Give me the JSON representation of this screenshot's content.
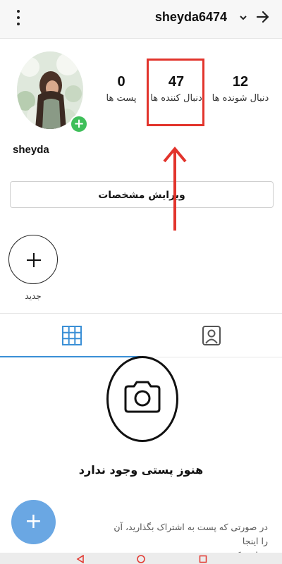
{
  "header": {
    "username": "sheyda6474",
    "menu_icon": "kebab-menu-icon",
    "dropdown_icon": "chevron-down-icon",
    "back_icon": "arrow-right-icon"
  },
  "profile": {
    "display_name": "sheyda",
    "stats": {
      "posts": {
        "count": "0",
        "label": "پست ها"
      },
      "followers": {
        "count": "47",
        "label": "دنبال کننده ها"
      },
      "following": {
        "count": "12",
        "label": "دنبال شونده ها"
      }
    },
    "edit_button": "ویرایش مشخصات"
  },
  "stories": {
    "new_label": "جدید"
  },
  "tabs": [
    {
      "name": "grid",
      "icon": "grid-icon",
      "active": true
    },
    {
      "name": "tagged",
      "icon": "tagged-person-icon",
      "active": false
    }
  ],
  "empty_state": {
    "title": "هنوز پستی وجود ندارد",
    "subtitle_line1": "در صورتی که پست به اشتراک بگذارید، آن را اینجا",
    "subtitle_line2": "خواهید کرد"
  },
  "annotation": {
    "highlight_color": "#e2342c"
  },
  "colors": {
    "accent": "#3a8fd6",
    "fab": "#6aa7e3",
    "badge": "#3fbf5a"
  }
}
